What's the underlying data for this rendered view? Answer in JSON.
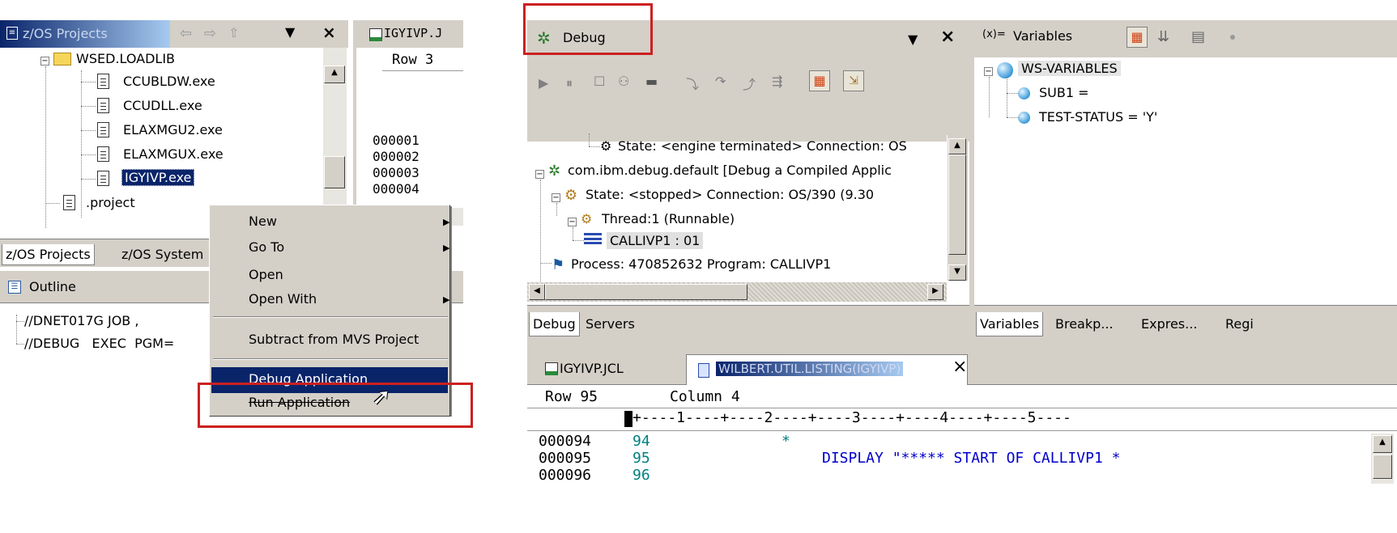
{
  "left_panel": {
    "project_view_title": "z/OS Projects",
    "editor_tab_label": "IGYIVP.J",
    "editor_row": "Row 3",
    "editor_lines": [
      "000001",
      "000002",
      "000003",
      "000004"
    ],
    "tree": [
      {
        "label": "WSED.LOADLIB",
        "kind": "folder"
      },
      {
        "label": "CCUBLDW.exe",
        "kind": "file"
      },
      {
        "label": "CCUDLL.exe",
        "kind": "file"
      },
      {
        "label": "ELAXMGU2.exe",
        "kind": "file"
      },
      {
        "label": "ELAXMGUX.exe",
        "kind": "file"
      },
      {
        "label": "IGYIVP.exe",
        "kind": "file",
        "selected": true
      },
      {
        "label": ".project",
        "kind": "file"
      }
    ],
    "bottom_tabs": [
      "z/OS Projects",
      "z/OS System"
    ],
    "outline_title": "Outline",
    "outline_items": [
      "//DNET017G JOB ,",
      "//DEBUG   EXEC  PGM="
    ],
    "context_menu": [
      {
        "label": "New",
        "submenu": true
      },
      {
        "label": "Go To",
        "submenu": true
      },
      {
        "label": "Open",
        "submenu": false
      },
      {
        "label": "Open With",
        "submenu": true
      },
      {
        "label": "Subtract from MVS Project",
        "submenu": false
      },
      {
        "label": "Debug Application",
        "submenu": false,
        "highlighted": true
      },
      {
        "label": "Run Application",
        "submenu": false
      }
    ]
  },
  "debug_panel": {
    "title": "Debug",
    "tree": [
      "State: <engine terminated> Connection: OS",
      "com.ibm.debug.default [Debug a Compiled Applic",
      "State: <stopped> Connection: OS/390 (9.30",
      "Thread:1 (Runnable)",
      "CALLIVP1 : 01",
      "Process: 470852632  Program: CALLIVP1"
    ],
    "tabs": [
      "Debug",
      "Servers"
    ]
  },
  "variables_panel": {
    "title": "Variables",
    "tree": [
      "WS-VARIABLES",
      "SUB1 =",
      "TEST-STATUS = 'Y'"
    ],
    "tabs": [
      "Variables",
      "Breakp...",
      "Expres...",
      "Regi"
    ]
  },
  "editor_panel": {
    "tabs": [
      "IGYIVP.JCL",
      "WILBERT.UTIL.LISTING(IGYIVP)"
    ],
    "row_label": "Row 95",
    "column_label": "Column 4",
    "ruler": "+----1----+----2----+----3----+----4----+----5----",
    "lines": [
      {
        "seq": "000094",
        "num": "94",
        "text": "*"
      },
      {
        "seq": "000095",
        "num": "95",
        "text": "DISPLAY \"***** START OF CALLIVP1 *"
      },
      {
        "seq": "000096",
        "num": "96",
        "text": ""
      }
    ]
  },
  "colors": {
    "highlight_red": "#cc2020",
    "selection": "#0a246a",
    "listing_text": "#0000cc",
    "linenum": "#008080"
  }
}
